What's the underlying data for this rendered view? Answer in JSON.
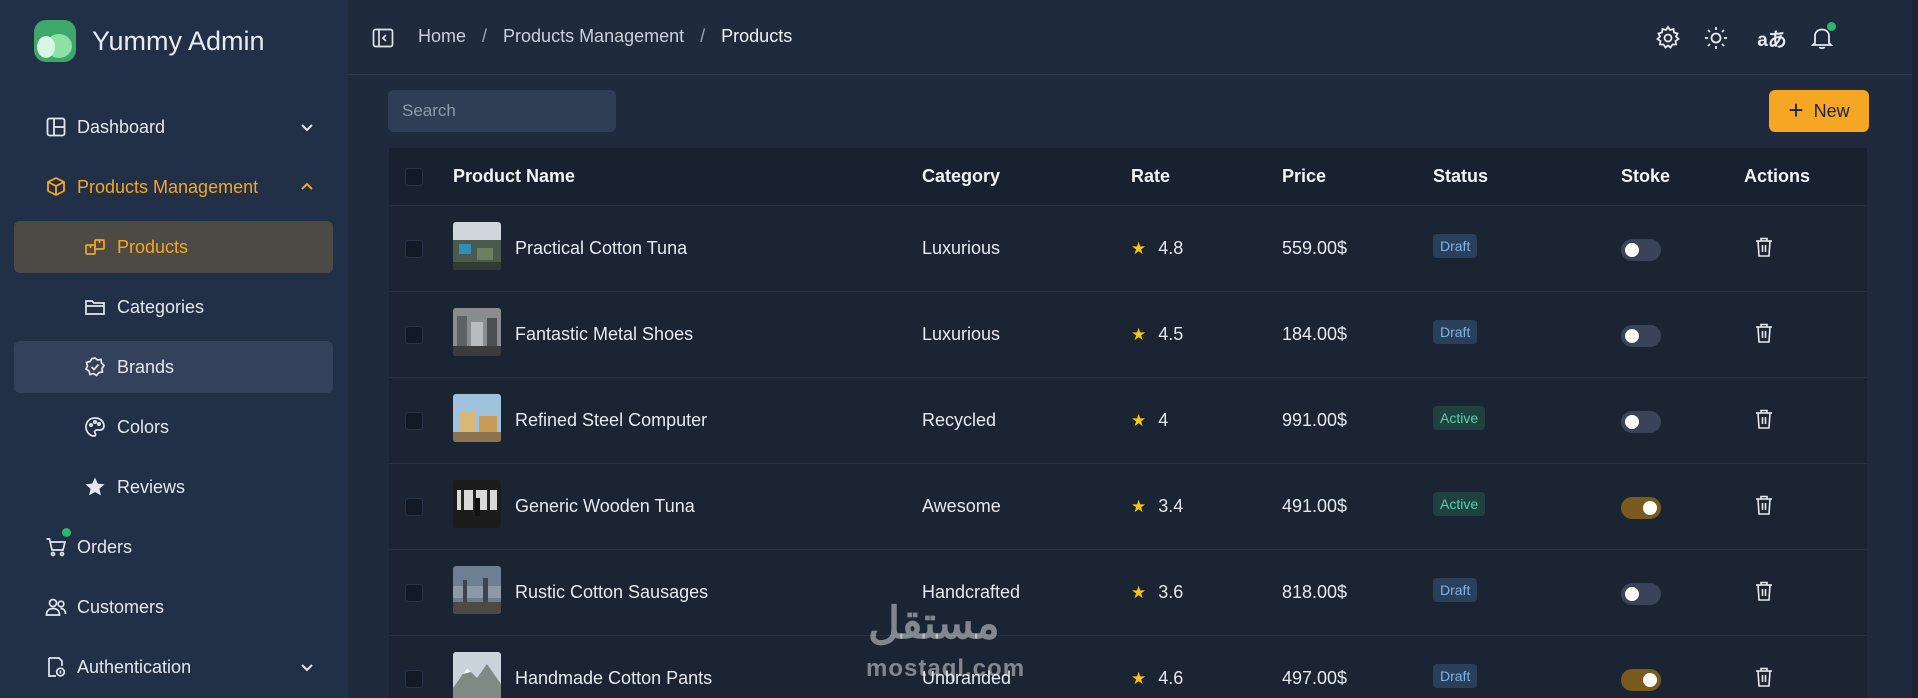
{
  "app": {
    "name": "Yummy Admin"
  },
  "sidebar": {
    "items": [
      {
        "label": "Dashboard",
        "icon": "layout-icon",
        "chevron": "chevron-down-icon"
      },
      {
        "label": "Products Management",
        "icon": "box-icon",
        "chevron": "chevron-up-icon"
      },
      {
        "label": "Products",
        "icon": "boxes-icon"
      },
      {
        "label": "Categories",
        "icon": "folder-icon"
      },
      {
        "label": "Brands",
        "icon": "badge-check-icon"
      },
      {
        "label": "Colors",
        "icon": "palette-icon"
      },
      {
        "label": "Reviews",
        "icon": "star-icon"
      },
      {
        "label": "Orders",
        "icon": "cart-icon"
      },
      {
        "label": "Customers",
        "icon": "users-icon"
      },
      {
        "label": "Authentication",
        "icon": "user-lock-icon",
        "chevron": "chevron-down-icon"
      }
    ]
  },
  "header": {
    "breadcrumbs": [
      "Home",
      "Products Management",
      "Products"
    ],
    "separator": "/",
    "lang_label": "aあ",
    "accent": "#f5a623"
  },
  "toolbar": {
    "search_placeholder": "Search",
    "new_label": "New"
  },
  "table": {
    "columns": [
      "Product Name",
      "Category",
      "Rate",
      "Price",
      "Status",
      "Stoke",
      "Actions"
    ],
    "rows": [
      {
        "name": "Practical Cotton Tuna",
        "category": "Luxurious",
        "rate": "4.8",
        "price": "559.00$",
        "status": "Draft",
        "stoke": false
      },
      {
        "name": "Fantastic Metal Shoes",
        "category": "Luxurious",
        "rate": "4.5",
        "price": "184.00$",
        "status": "Draft",
        "stoke": false
      },
      {
        "name": "Refined Steel Computer",
        "category": "Recycled",
        "rate": "4",
        "price": "991.00$",
        "status": "Active",
        "stoke": false
      },
      {
        "name": "Generic Wooden Tuna",
        "category": "Awesome",
        "rate": "3.4",
        "price": "491.00$",
        "status": "Active",
        "stoke": true
      },
      {
        "name": "Rustic Cotton Sausages",
        "category": "Handcrafted",
        "rate": "3.6",
        "price": "818.00$",
        "status": "Draft",
        "stoke": false
      },
      {
        "name": "Handmade Cotton Pants",
        "category": "Unbranded",
        "rate": "4.6",
        "price": "497.00$",
        "status": "Draft",
        "stoke": true
      }
    ]
  },
  "watermark": {
    "arabic": "مستقل",
    "latin": "mostaql.com"
  }
}
